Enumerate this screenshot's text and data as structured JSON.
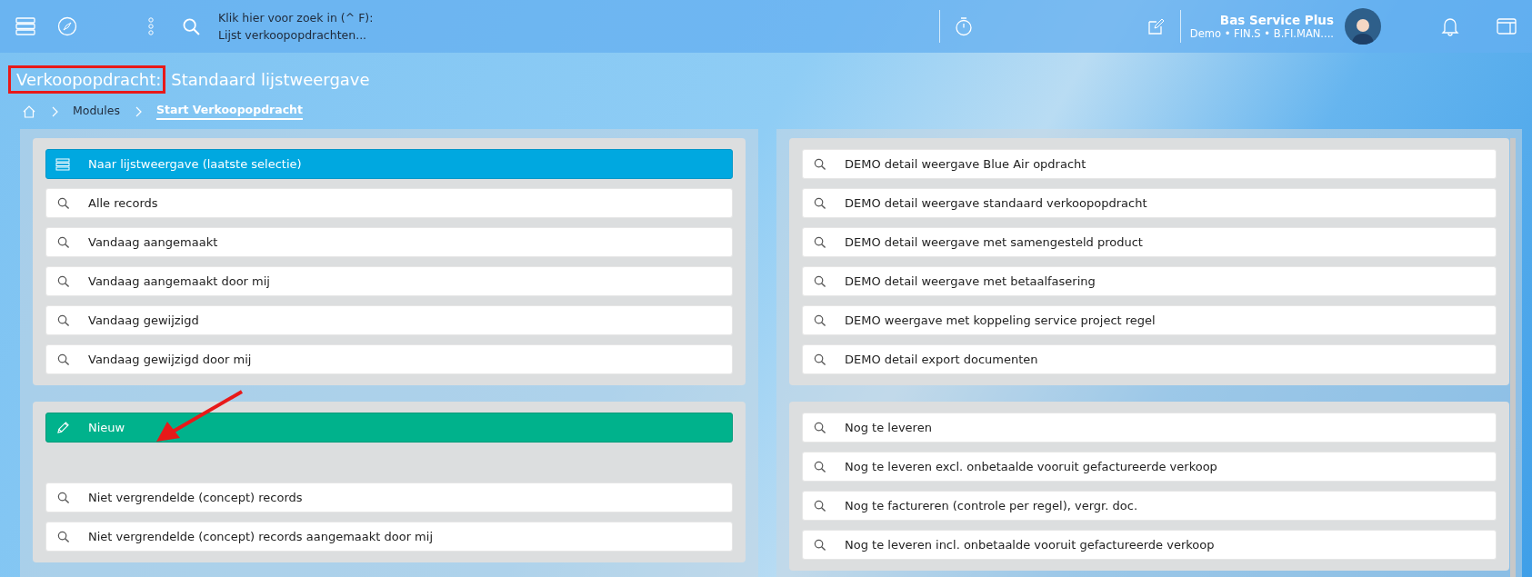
{
  "topbar": {
    "search_hint": "Klik hier voor zoek in (^ F):",
    "search_context": "Lijst verkoopopdrachten...",
    "user_name": "Bas Service Plus",
    "user_context": "Demo • FIN.S • B.FI.MAN...."
  },
  "page": {
    "title_prefix": "Verkoopopdracht:",
    "title": "Standaard lijstweergave"
  },
  "breadcrumb": [
    {
      "label": "Modules",
      "selected": false
    },
    {
      "label": "Start Verkoopopdracht",
      "selected": true
    }
  ],
  "left_groups": [
    {
      "items": [
        {
          "kind": "list",
          "label": "Naar lijstweergave (laatste selectie)"
        },
        {
          "kind": "search",
          "label": "Alle records"
        },
        {
          "kind": "search",
          "label": "Vandaag aangemaakt"
        },
        {
          "kind": "search",
          "label": "Vandaag aangemaakt door mij"
        },
        {
          "kind": "search",
          "label": "Vandaag gewijzigd"
        },
        {
          "kind": "search",
          "label": "Vandaag gewijzigd door mij"
        }
      ]
    },
    {
      "items": [
        {
          "kind": "new",
          "label": "Nieuw"
        }
      ]
    },
    {
      "items": [
        {
          "kind": "search",
          "label": "Niet vergrendelde (concept) records"
        },
        {
          "kind": "search",
          "label": "Niet vergrendelde (concept) records aangemaakt door mij"
        }
      ]
    }
  ],
  "right_groups": [
    {
      "items": [
        {
          "kind": "search",
          "label": "DEMO detail weergave Blue Air opdracht"
        },
        {
          "kind": "search",
          "label": "DEMO detail weergave standaard verkoopopdracht"
        },
        {
          "kind": "search",
          "label": "DEMO detail weergave met samengesteld product"
        },
        {
          "kind": "search",
          "label": "DEMO detail weergave met betaalfasering"
        },
        {
          "kind": "search",
          "label": "DEMO weergave met koppeling service project regel"
        },
        {
          "kind": "search",
          "label": "DEMO detail export documenten"
        }
      ]
    },
    {
      "items": [
        {
          "kind": "search",
          "label": "Nog te leveren"
        },
        {
          "kind": "search",
          "label": "Nog te leveren excl. onbetaalde vooruit gefactureerde verkoop"
        },
        {
          "kind": "search",
          "label": "Nog te factureren (controle per regel), vergr. doc."
        },
        {
          "kind": "search",
          "label": "Nog te leveren incl. onbetaalde vooruit gefactureerde verkoop"
        }
      ]
    }
  ]
}
